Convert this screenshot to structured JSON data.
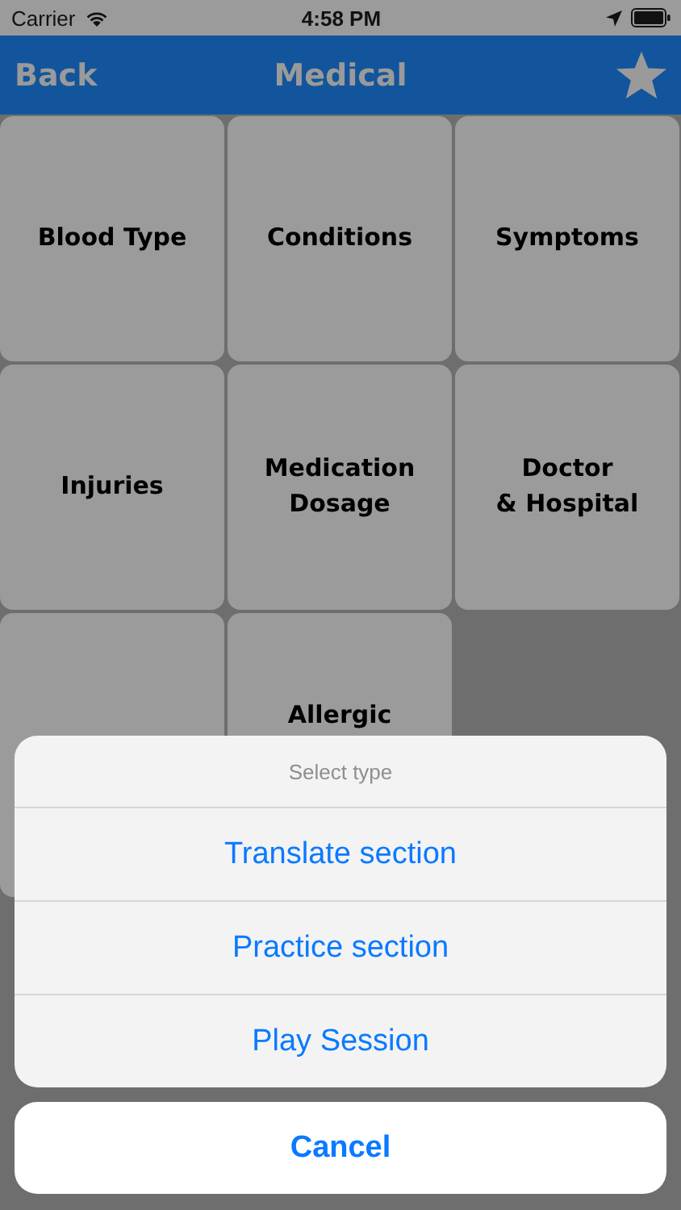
{
  "status_bar": {
    "carrier": "Carrier",
    "time": "4:58 PM"
  },
  "nav_bar": {
    "back": "Back",
    "title": "Medical"
  },
  "tiles": [
    {
      "kind": "labeled",
      "label": "Blood Type"
    },
    {
      "kind": "labeled",
      "label": "Conditions"
    },
    {
      "kind": "labeled",
      "label": "Symptoms"
    },
    {
      "kind": "labeled",
      "label": "Injuries"
    },
    {
      "kind": "labeled",
      "label": "Medication Dosage"
    },
    {
      "kind": "labeled",
      "label": "Doctor\n& Hospital"
    },
    {
      "kind": "covered"
    },
    {
      "kind": "labeled",
      "label": "Allergic"
    }
  ],
  "action_sheet": {
    "title": "Select type",
    "actions": [
      "Translate section",
      "Practice section",
      "Play Session"
    ],
    "cancel": "Cancel"
  }
}
